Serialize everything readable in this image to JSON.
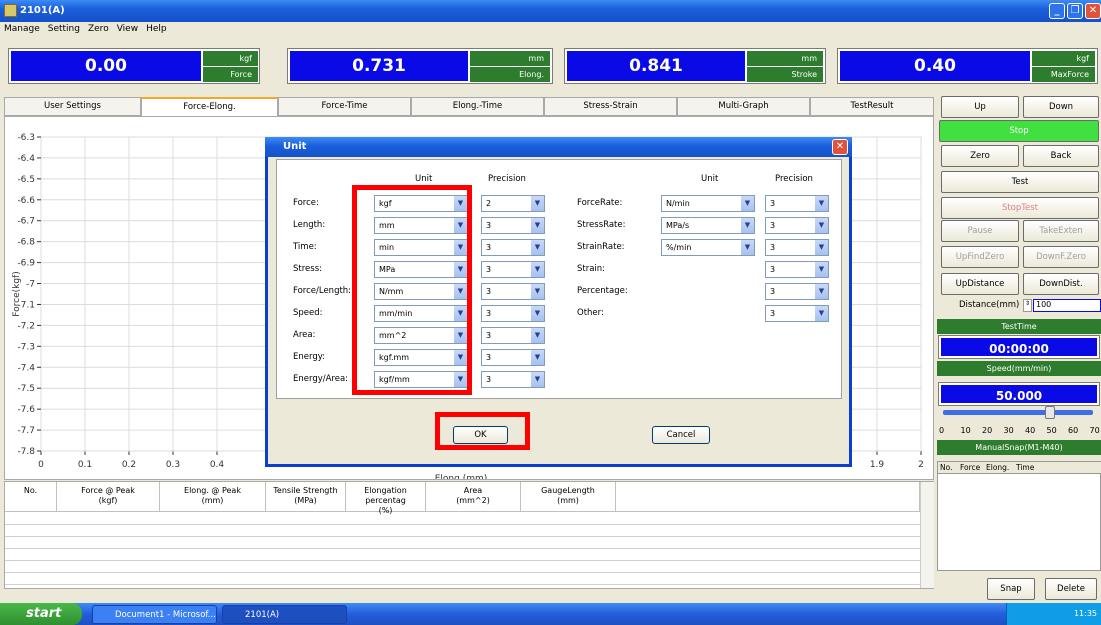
{
  "window": {
    "title": "2101(A)"
  },
  "menu": [
    "Manage",
    "Setting",
    "Zero",
    "View",
    "Help"
  ],
  "readouts": [
    {
      "value": "0.00",
      "unit": "kgf",
      "label": "Force"
    },
    {
      "value": "0.731",
      "unit": "mm",
      "label": "Elong."
    },
    {
      "value": "0.841",
      "unit": "mm",
      "label": "Stroke"
    },
    {
      "value": "0.40",
      "unit": "kgf",
      "label": "MaxForce"
    }
  ],
  "tabs": [
    "User Settings",
    "Force-Elong.",
    "Force-Time",
    "Elong.-Time",
    "Stress-Strain",
    "Multi-Graph",
    "TestResult"
  ],
  "chart_data": {
    "type": "line",
    "xlabel": "Elong.(mm)",
    "ylabel": "Force(kgf)",
    "y_ticks": [
      "-6.3",
      "-6.4",
      "-6.5",
      "-6.6",
      "-6.7",
      "-6.8",
      "-6.9",
      "-7",
      "-7.1",
      "-7.2",
      "-7.3",
      "-7.4",
      "-7.5",
      "-7.6",
      "-7.7",
      "-7.8"
    ],
    "x_ticks": [
      "0",
      "0.1",
      "0.2",
      "0.3",
      "0.4"
    ],
    "x_ticks_right": [
      "1.9",
      "2"
    ],
    "ylim": [
      -7.8,
      -6.3
    ],
    "xlim": [
      0,
      2
    ],
    "grid": true,
    "series": []
  },
  "side": {
    "up": "Up",
    "down": "Down",
    "stop": "Stop",
    "zero": "Zero",
    "back": "Back",
    "test": "Test",
    "stoptest": "StopTest",
    "pause": "Pause",
    "takeexten": "TakeExten",
    "upfindzero": "UpFindZero",
    "downfzero": "DownF.Zero",
    "updistance": "UpDistance",
    "downdist": "DownDist.",
    "distance_label": "Distance(mm)",
    "distance_value": "100",
    "testtime_label": "TestTime",
    "testtime": "00:00:00",
    "speed_label": "Speed(mm/min)",
    "speed": "50.000",
    "scale": [
      "0",
      "10",
      "20",
      "30",
      "40",
      "50",
      "60",
      "70"
    ],
    "slider_level_mm_min": 50,
    "snap_label": "ManualSnap(M1-M40)",
    "snap_cols": [
      "No.",
      "Force",
      "Elong.",
      "Time"
    ],
    "snap": "Snap",
    "delete": "Delete"
  },
  "results": {
    "cols": [
      {
        "l1": "No.",
        "l2": ""
      },
      {
        "l1": "Force @ Peak",
        "l2": "(kgf)"
      },
      {
        "l1": "Elong. @ Peak",
        "l2": "(mm)"
      },
      {
        "l1": "Tensile Strength",
        "l2": "(MPa)"
      },
      {
        "l1": "Elongation percentag",
        "l2": "(%)"
      },
      {
        "l1": "Area",
        "l2": "(mm^2)"
      },
      {
        "l1": "GaugeLength",
        "l2": "(mm)"
      }
    ]
  },
  "dialog": {
    "title": "Unit",
    "unit_header": "Unit",
    "precision_header": "Precision",
    "left": [
      {
        "label": "Force:",
        "unit": "kgf",
        "precision": "2"
      },
      {
        "label": "Length:",
        "unit": "mm",
        "precision": "3"
      },
      {
        "label": "Time:",
        "unit": "min",
        "precision": "3"
      },
      {
        "label": "Stress:",
        "unit": "MPa",
        "precision": "3"
      },
      {
        "label": "Force/Length:",
        "unit": "N/mm",
        "precision": "3"
      },
      {
        "label": "Speed:",
        "unit": "mm/min",
        "precision": "3"
      },
      {
        "label": "Area:",
        "unit": "mm^2",
        "precision": "3"
      },
      {
        "label": "Energy:",
        "unit": "kgf.mm",
        "precision": "3"
      },
      {
        "label": "Energy/Area:",
        "unit": "kgf/mm",
        "precision": "3"
      }
    ],
    "right": [
      {
        "label": "ForceRate:",
        "unit": "N/min",
        "precision": "3"
      },
      {
        "label": "StressRate:",
        "unit": "MPa/s",
        "precision": "3"
      },
      {
        "label": "StrainRate:",
        "unit": "%/min",
        "precision": "3"
      },
      {
        "label": "Strain:",
        "unit": "",
        "precision": "3"
      },
      {
        "label": "Percentage:",
        "unit": "",
        "precision": "3"
      },
      {
        "label": "Other:",
        "unit": "",
        "precision": "3"
      }
    ],
    "ok": "OK",
    "cancel": "Cancel"
  },
  "taskbar": {
    "start": "start",
    "items": [
      "Document1 - Microsof...",
      "2101(A)"
    ],
    "clock": "11:35"
  },
  "colors": {
    "highlight": "#ff0000",
    "readout_blue": "#0a0ae6",
    "unit_green": "#2e7d2e",
    "stop_green": "#40e040"
  }
}
